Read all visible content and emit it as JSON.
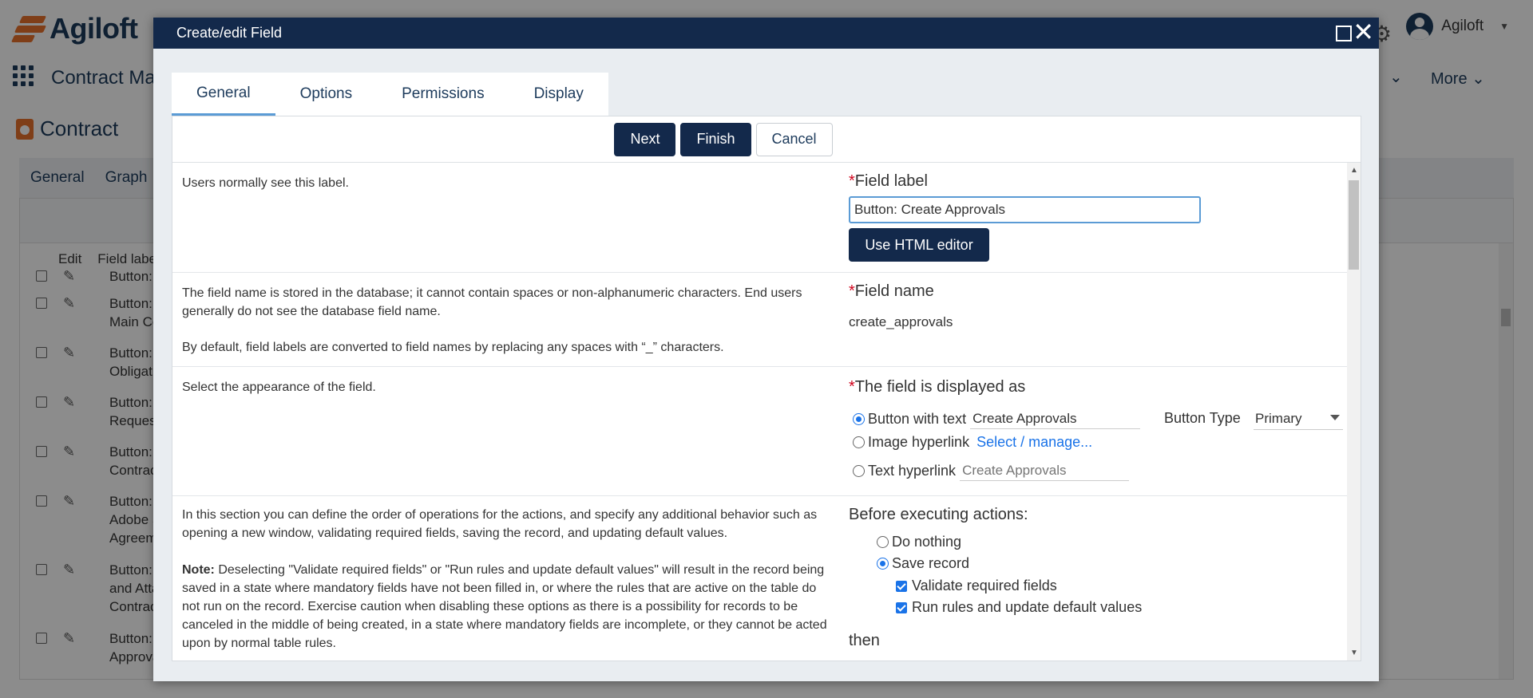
{
  "background": {
    "logo_text": "Agiloft",
    "user_name": "Agiloft",
    "app_name": "Contract Ma",
    "more_label": "More",
    "page_title": "Contract",
    "tabs": [
      "General",
      "Graph"
    ],
    "table_headers": {
      "edit": "Edit",
      "field_label": "Field label"
    },
    "rows": [
      {
        "line1": "Button: Ac",
        "line2": ""
      },
      {
        "line1": "Button: Ac",
        "line2": "Main Cont"
      },
      {
        "line1": "Button: Ac",
        "line2": "Obligation"
      },
      {
        "line1": "Button: Ac",
        "line2": "Requester"
      },
      {
        "line1": "Button: Ca",
        "line2": "Contract"
      },
      {
        "line1": "Button: Cr",
        "line2": "Adobe Sig",
        "line3": "Agreemen"
      },
      {
        "line1": "Button: Cr",
        "line2": "and Attach",
        "line3": "Contract"
      },
      {
        "line1": "Button: Cr",
        "line2": "Approvals"
      }
    ]
  },
  "dialog": {
    "title": "Create/edit Field",
    "tabs": [
      "General",
      "Options",
      "Permissions",
      "Display"
    ],
    "buttons": {
      "next": "Next",
      "finish": "Finish",
      "cancel": "Cancel"
    },
    "field_label": {
      "description": "Users normally see this label.",
      "label": "Field label",
      "value": "Button: Create Approvals",
      "html_editor_button": "Use HTML editor"
    },
    "field_name": {
      "description_1": "The field name is stored in the database; it cannot contain spaces or non-alphanumeric characters. End users generally do not see the database field name.",
      "description_2": "By default, field labels are converted to field names by replacing any spaces with “_” characters.",
      "label": "Field name",
      "value": "create_approvals"
    },
    "display_as": {
      "description": "Select the appearance of the field.",
      "label": "The field is displayed as",
      "option_button": "Button with text",
      "button_text_value": "Create Approvals",
      "button_type_label": "Button Type",
      "button_type_value": "Primary",
      "option_image": "Image hyperlink",
      "image_link": "Select / manage...",
      "option_text": "Text hyperlink",
      "text_hyperlink_placeholder": "Create Approvals",
      "selected": "button"
    },
    "before_actions": {
      "description": "In this section you can define the order of operations for the actions, and specify any additional behavior such as opening a new window, validating required fields, saving the record, and updating default values.",
      "note_label": "Note:",
      "note_text": " Deselecting \"Validate required fields\" or \"Run rules and update default values\" will result in the record being saved in a state where mandatory fields have not been filled in, or where the rules that are active on the table do not run on the record. Exercise caution when disabling these options as there is a possibility for records to be canceled in the middle of being created, in a state where mandatory fields are incomplete, or they cannot be acted upon by normal table rules.",
      "label": "Before executing actions:",
      "opt_nothing": "Do nothing",
      "opt_save": "Save record",
      "chk_validate": "Validate required fields",
      "chk_rules": "Run rules and update default values",
      "then_label": "then"
    }
  }
}
